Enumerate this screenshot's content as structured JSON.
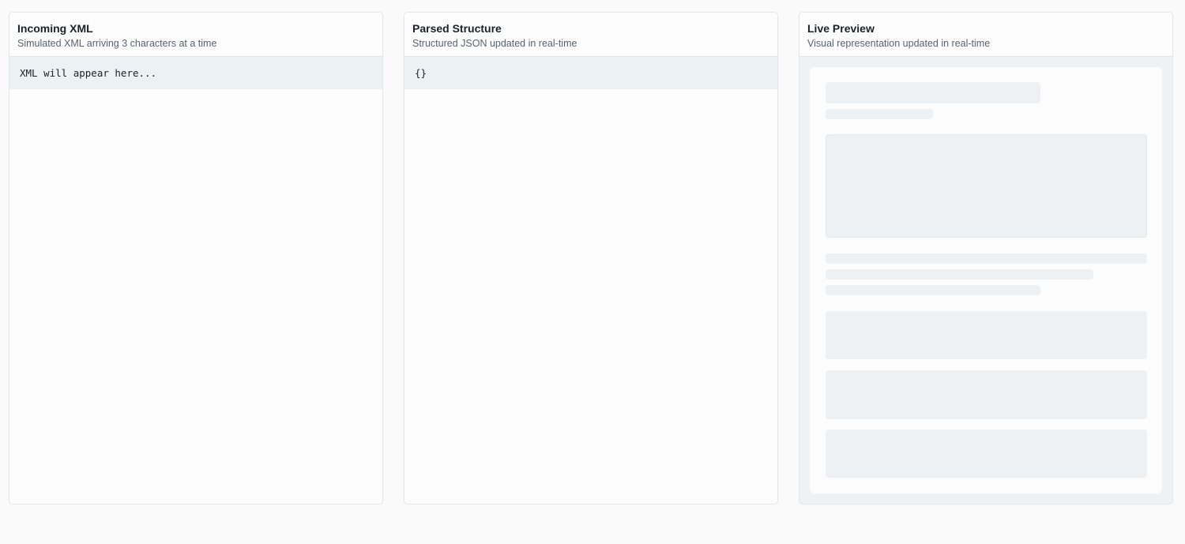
{
  "panels": {
    "incoming": {
      "title": "Incoming XML",
      "subtitle": "Simulated XML arriving 3 characters at a time",
      "content": "XML will appear here..."
    },
    "parsed": {
      "title": "Parsed Structure",
      "subtitle": "Structured JSON updated in real-time",
      "content": "{}"
    },
    "preview": {
      "title": "Live Preview",
      "subtitle": "Visual representation updated in real-time"
    }
  },
  "colors": {
    "page_background": "#fafafa",
    "skeleton": "#edf1f4",
    "code_background": "#ecf1f4",
    "title_text": "#1d2127",
    "subtitle_text": "#5b636d"
  }
}
